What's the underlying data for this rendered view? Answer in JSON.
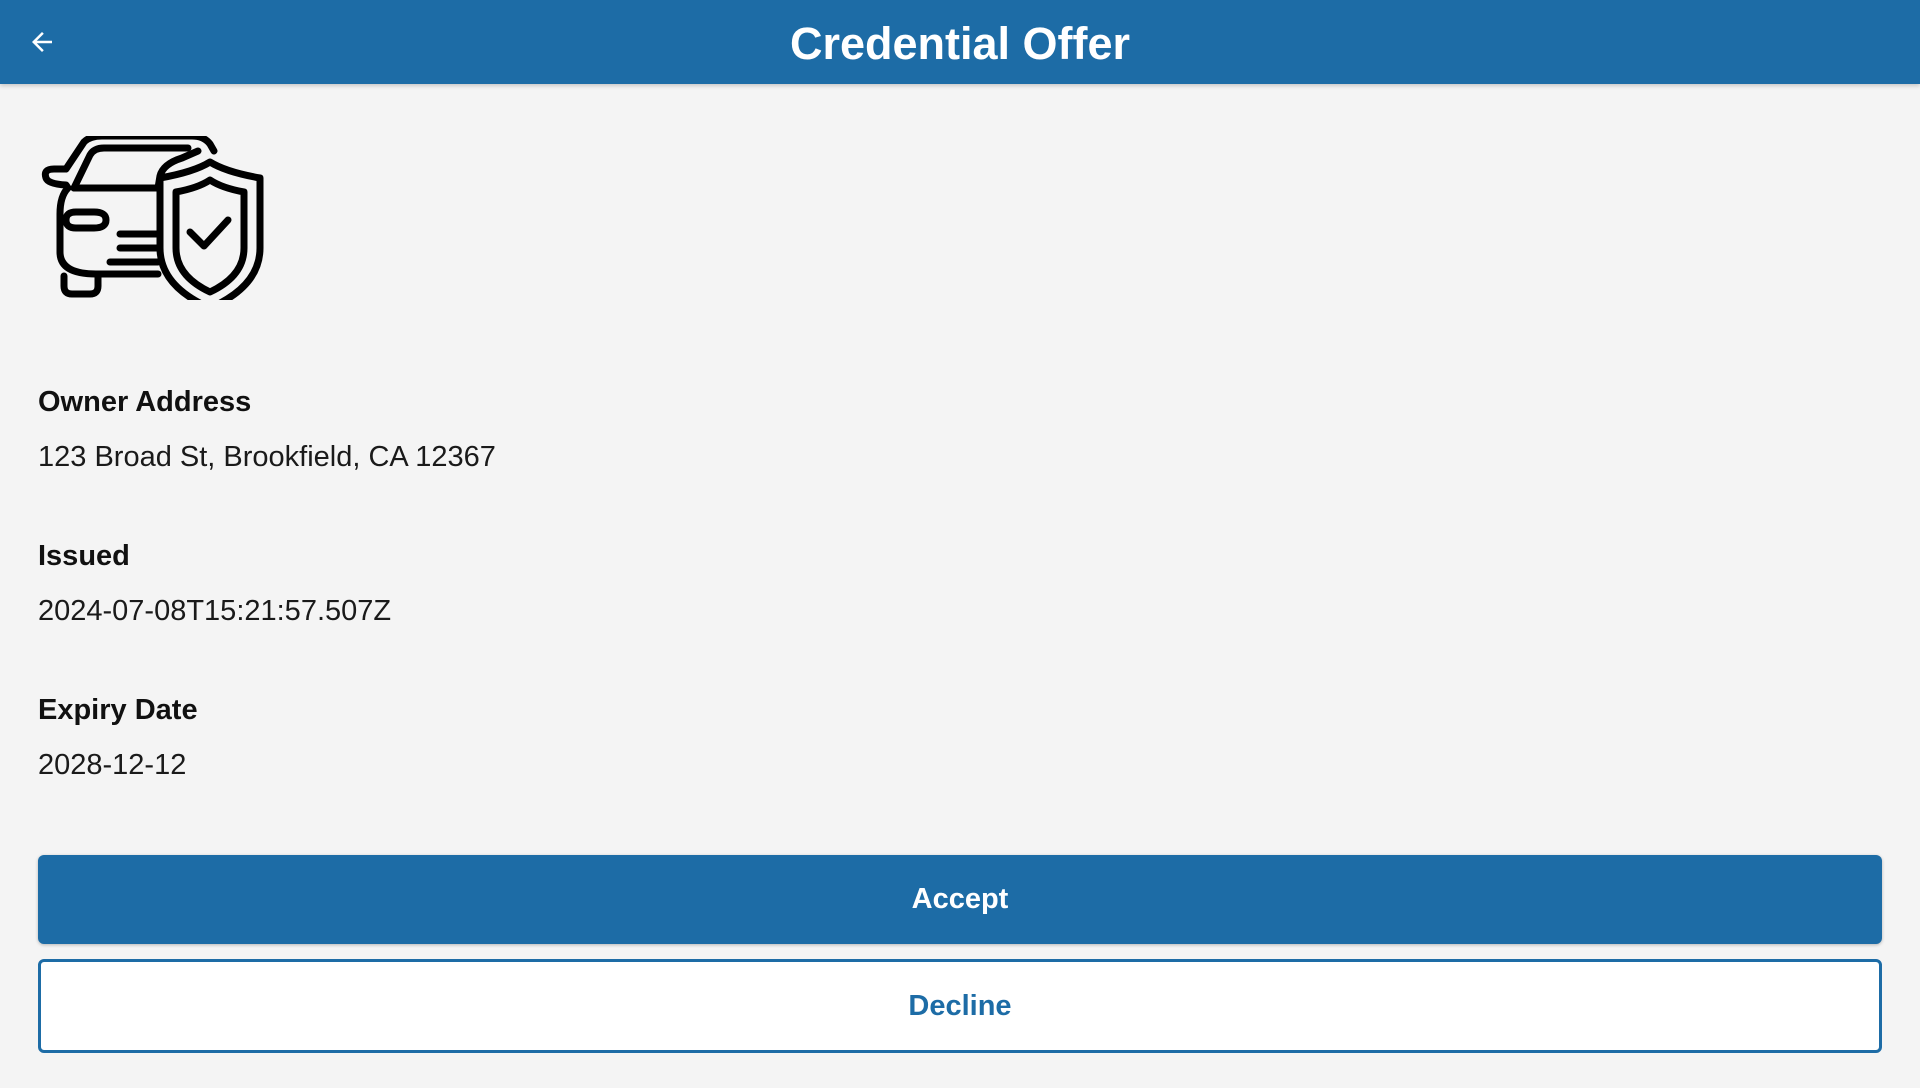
{
  "header": {
    "title": "Credential Offer",
    "back_icon": "arrow-left-icon",
    "background": "#1d6ca6"
  },
  "credential": {
    "icon": "car-shield-check-icon",
    "fields": [
      {
        "label": "Owner Address",
        "value": "123 Broad St, Brookfield, CA 12367"
      },
      {
        "label": "Issued",
        "value": "2024-07-08T15:21:57.507Z"
      },
      {
        "label": "Expiry Date",
        "value": "2028-12-12"
      }
    ]
  },
  "actions": {
    "accept_label": "Accept",
    "decline_label": "Decline",
    "accent_color": "#1d6ca6"
  }
}
